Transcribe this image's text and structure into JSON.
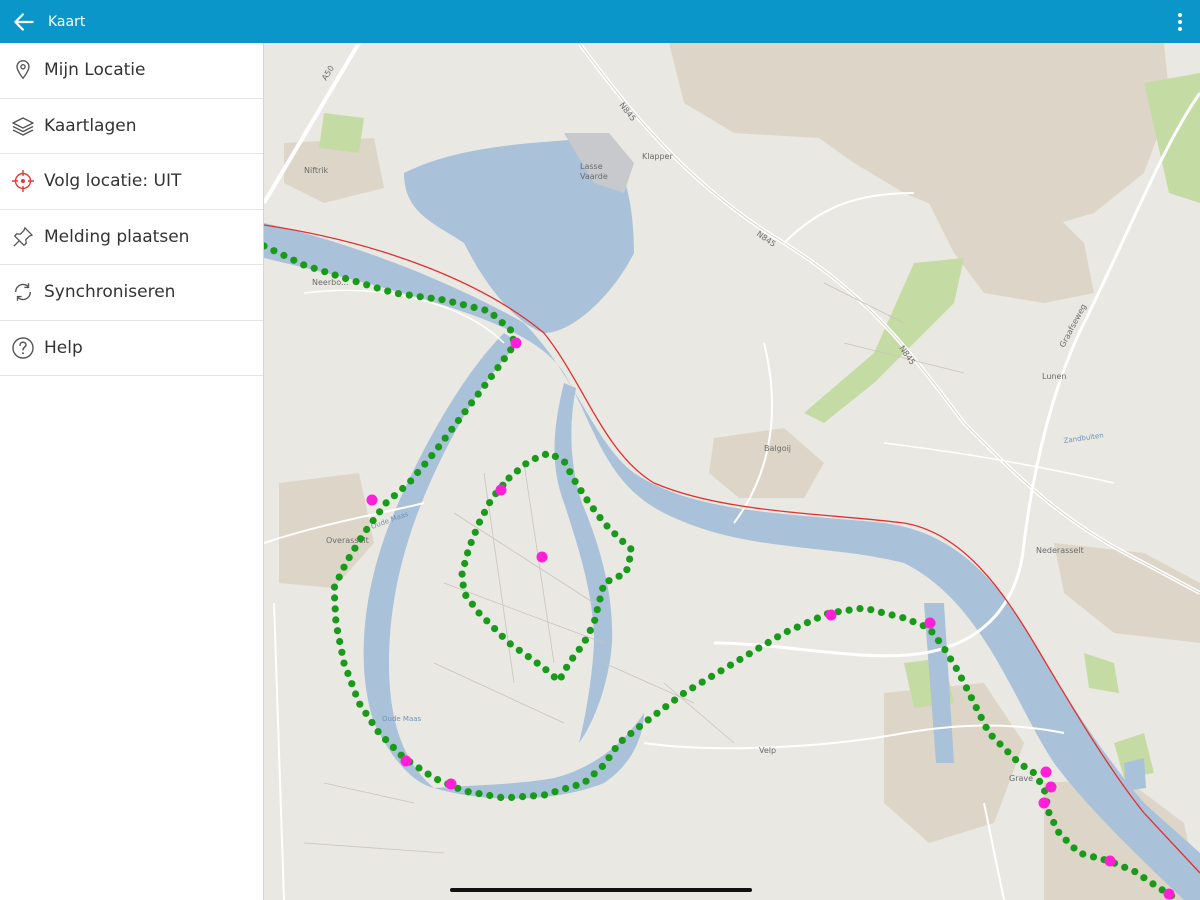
{
  "app": {
    "title": "Kaart"
  },
  "sidebar": {
    "items": [
      {
        "label": "Mijn Locatie",
        "icon": "location-pin-icon"
      },
      {
        "label": "Kaartlagen",
        "icon": "layers-icon"
      },
      {
        "label": "Volg locatie: UIT",
        "icon": "crosshair-icon",
        "icon_color": "#e53935"
      },
      {
        "label": "Melding plaatsen",
        "icon": "pushpin-icon"
      },
      {
        "label": "Synchroniseren",
        "icon": "sync-icon"
      },
      {
        "label": "Help",
        "icon": "help-icon"
      }
    ]
  },
  "map": {
    "place_labels": {
      "niftrik": "Niftrik",
      "neerbosch": "Neerbo...",
      "balgoij": "Balgoij",
      "overasselt": "Overasselt",
      "nederasselt": "Nederasselt",
      "velp": "Velp",
      "grave": "Grave",
      "lunen": "Lunen",
      "klapper": "Klapper",
      "lasse": "Lasse",
      "vaarde": "Vaarde"
    },
    "road_labels": {
      "a50": "A50",
      "n845_north": "N845",
      "n845_mid": "N845",
      "n845_south": "N845",
      "graafseweg": "Graafseweg"
    },
    "water_labels": {
      "oude_maas_west": "Oude Maas",
      "oude_maas_south": "Oude Maas",
      "zandbulten": "Zandbulten"
    },
    "colors": {
      "land": "#eae8e3",
      "water": "#a9c2d9",
      "green": "#c5dba4",
      "residential": "#ddd6c8",
      "route_dot": "#1a9a1a",
      "waypoint": "#ff1fd6",
      "rail": "#e0302f"
    }
  }
}
